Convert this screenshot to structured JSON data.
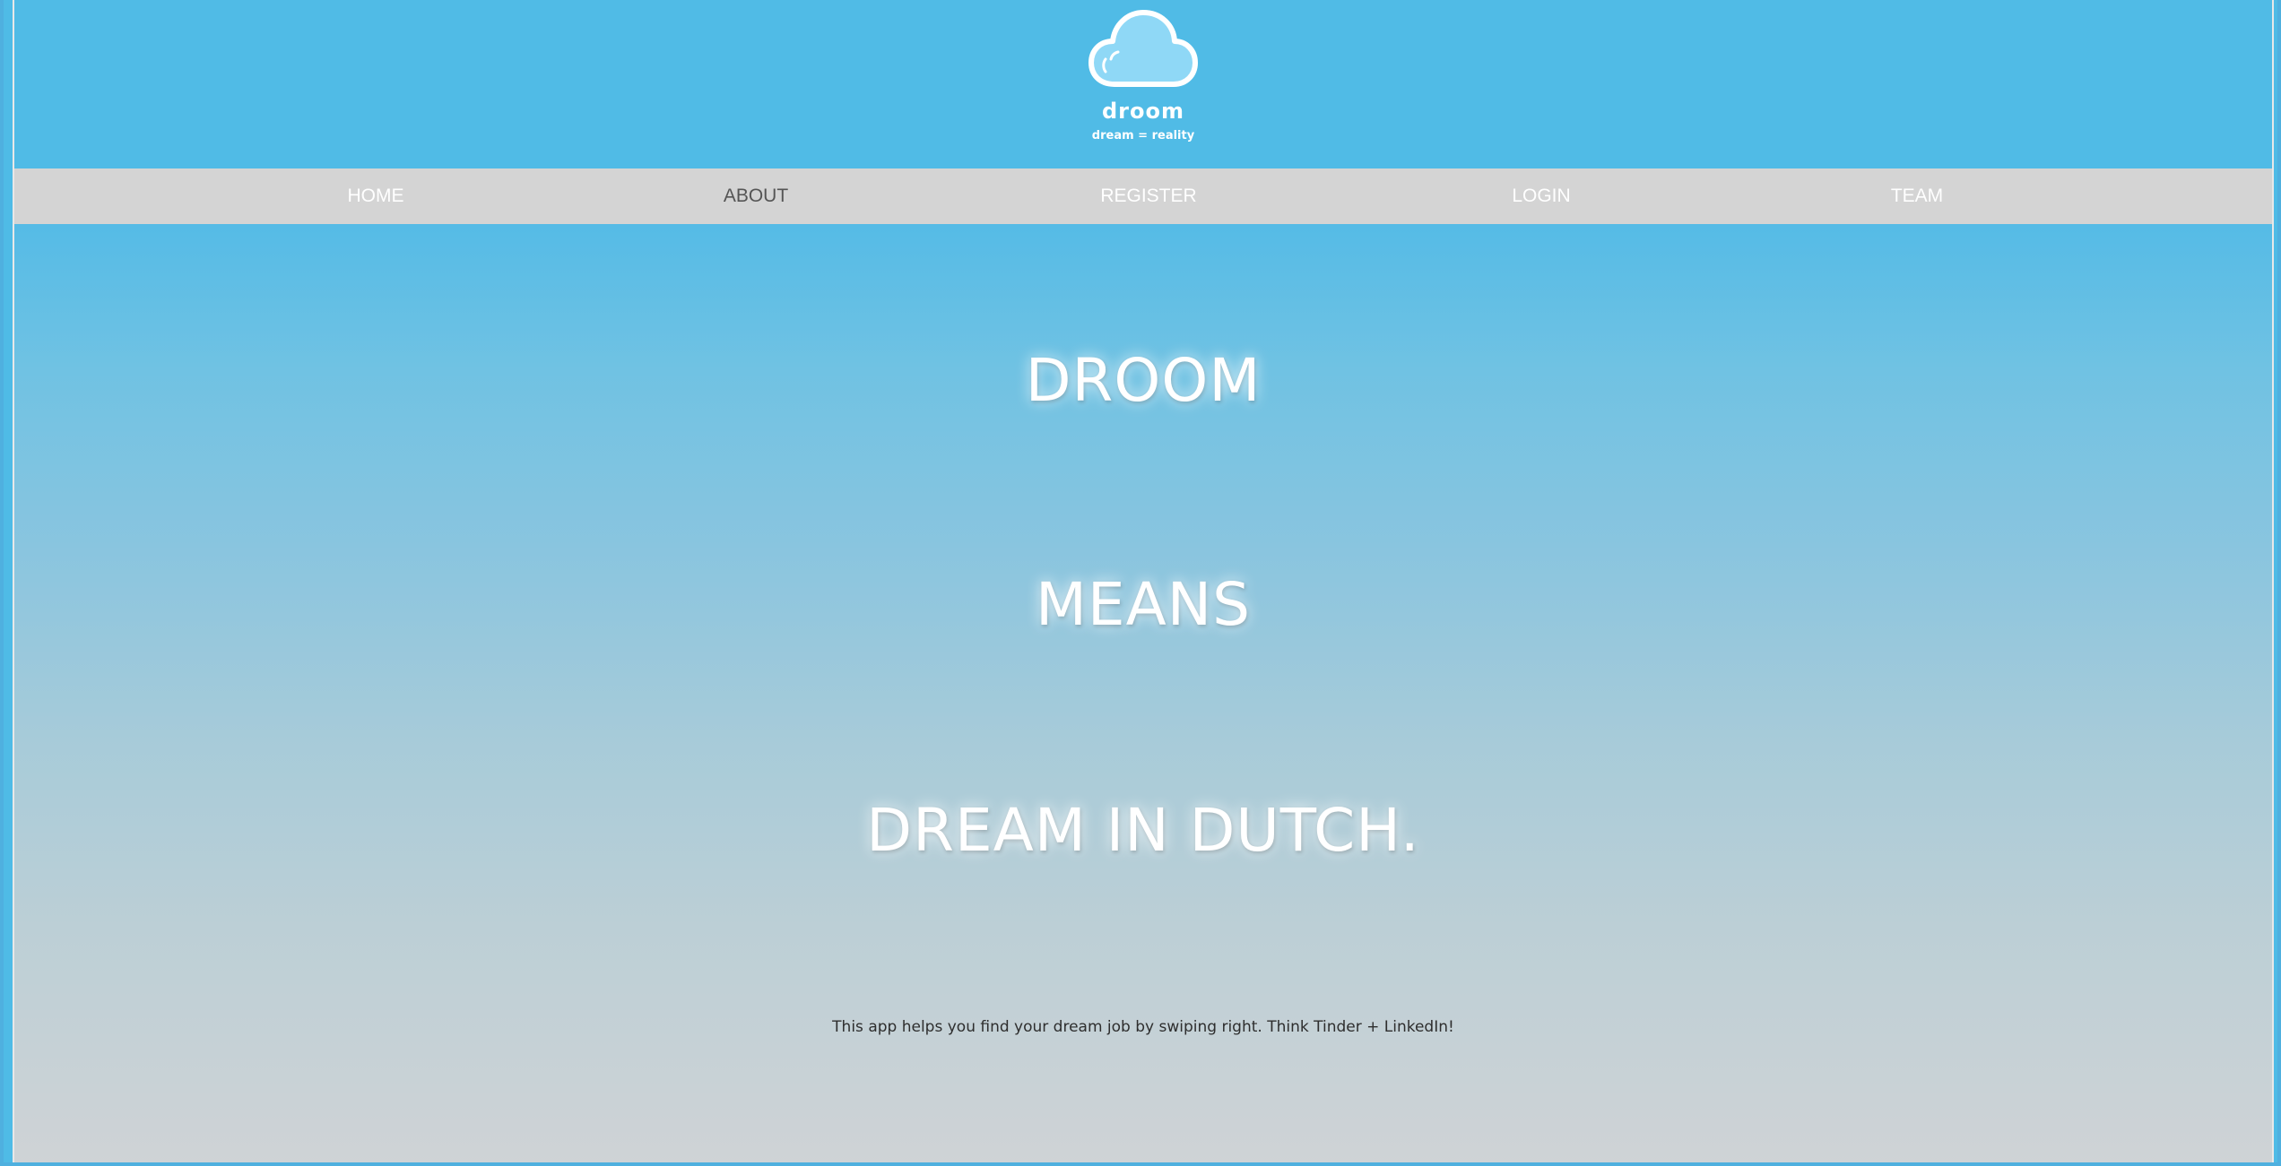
{
  "header": {
    "brand": "droom",
    "tagline": "dream = reality",
    "logo_icon": "cloud-icon"
  },
  "nav": {
    "items": [
      {
        "label": "HOME",
        "active": false
      },
      {
        "label": "ABOUT",
        "active": true
      },
      {
        "label": "REGISTER",
        "active": false
      },
      {
        "label": "LOGIN",
        "active": false
      },
      {
        "label": "TEAM",
        "active": false
      }
    ]
  },
  "main": {
    "headline_1": "DROOM",
    "headline_2": "MEANS",
    "headline_3": "DREAM IN DUTCH.",
    "description": "This app helps you find your dream job by swiping right. Think Tinder + LinkedIn!"
  },
  "colors": {
    "header_bg": "#50bbe6",
    "nav_bg": "#d4d4d4",
    "active_nav": "#555555",
    "text_light": "#ffffff"
  }
}
